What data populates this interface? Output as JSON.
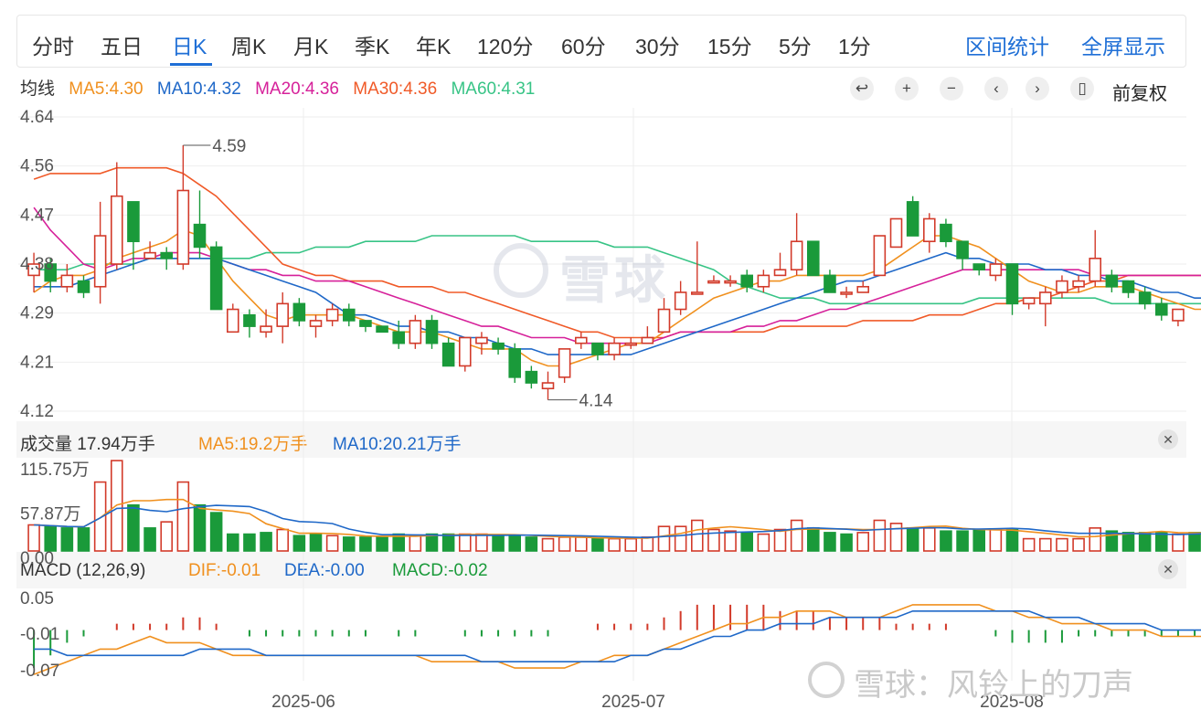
{
  "tabs": [
    "分时",
    "五日",
    "日K",
    "周K",
    "月K",
    "季K",
    "年K",
    "120分",
    "60分",
    "30分",
    "15分",
    "5分",
    "1分"
  ],
  "active_tab": "日K",
  "right_tabs": [
    "区间统计",
    "全屏显示"
  ],
  "ma_legend": {
    "label": "均线",
    "ma5": "MA5:4.30",
    "ma10": "MA10:4.32",
    "ma20": "MA20:4.36",
    "ma30": "MA30:4.36",
    "ma60": "MA60:4.31"
  },
  "toolbar": {
    "icons": [
      "undo-icon",
      "zoom-in-icon",
      "zoom-out-icon",
      "scroll-left-icon",
      "scroll-right-icon",
      "candle-type-icon"
    ],
    "fuquan": "前复权"
  },
  "volume_legend": {
    "label": "成交量 17.94万手",
    "ma5": "MA5:19.2万手",
    "ma10": "MA10:20.21万手"
  },
  "macd_legend": {
    "label": "MACD (12,26,9)",
    "dif": "DIF:-0.01",
    "dea": "DEA:-0.00",
    "macd": "MACD:-0.02"
  },
  "watermark": {
    "center": "雪球",
    "bottom_right": "雪球：风铃上的刀声"
  },
  "colors": {
    "up": "#d23a2a",
    "down": "#1a9a3a",
    "ma5": "#f0901e",
    "ma10": "#1f68c8",
    "ma20": "#d6219a",
    "ma30": "#f05a28",
    "ma60": "#38c486",
    "accent": "#1f6fd6"
  },
  "chart_data": {
    "type": "candlestick",
    "x_ticks": [
      "2025-06",
      "2025-07",
      "2025-08"
    ],
    "price_ticks": [
      "4.64",
      "4.56",
      "4.47",
      "4.38",
      "4.29",
      "4.21",
      "4.12"
    ],
    "price_ylim": [
      4.12,
      4.64
    ],
    "high_label": "4.59",
    "low_label": "4.14",
    "volume_ticks": [
      "115.75万",
      "57.87万",
      "0.00"
    ],
    "volume_ylim": [
      0,
      115.75
    ],
    "macd_ticks": [
      "0.05",
      "-0.01",
      "-0.07"
    ],
    "macd_ylim": [
      -0.08,
      0.06
    ],
    "candles": [
      {
        "o": 4.36,
        "c": 4.38,
        "h": 4.4,
        "l": 4.33
      },
      {
        "o": 4.38,
        "c": 4.35,
        "h": 4.39,
        "l": 4.33
      },
      {
        "o": 4.34,
        "c": 4.36,
        "h": 4.38,
        "l": 4.33
      },
      {
        "o": 4.35,
        "c": 4.33,
        "h": 4.36,
        "l": 4.32
      },
      {
        "o": 4.34,
        "c": 4.43,
        "h": 4.49,
        "l": 4.31
      },
      {
        "o": 4.38,
        "c": 4.5,
        "h": 4.56,
        "l": 4.37
      },
      {
        "o": 4.49,
        "c": 4.42,
        "h": 4.49,
        "l": 4.37
      },
      {
        "o": 4.39,
        "c": 4.4,
        "h": 4.42,
        "l": 4.39
      },
      {
        "o": 4.4,
        "c": 4.39,
        "h": 4.41,
        "l": 4.37
      },
      {
        "o": 4.38,
        "c": 4.51,
        "h": 4.59,
        "l": 4.37
      },
      {
        "o": 4.45,
        "c": 4.41,
        "h": 4.51,
        "l": 4.39
      },
      {
        "o": 4.41,
        "c": 4.3,
        "h": 4.42,
        "l": 4.3
      },
      {
        "o": 4.26,
        "c": 4.3,
        "h": 4.31,
        "l": 4.26
      },
      {
        "o": 4.29,
        "c": 4.27,
        "h": 4.3,
        "l": 4.25
      },
      {
        "o": 4.26,
        "c": 4.27,
        "h": 4.3,
        "l": 4.25
      },
      {
        "o": 4.27,
        "c": 4.31,
        "h": 4.33,
        "l": 4.24
      },
      {
        "o": 4.31,
        "c": 4.28,
        "h": 4.32,
        "l": 4.27
      },
      {
        "o": 4.27,
        "c": 4.28,
        "h": 4.29,
        "l": 4.25
      },
      {
        "o": 4.28,
        "c": 4.3,
        "h": 4.31,
        "l": 4.27
      },
      {
        "o": 4.3,
        "c": 4.28,
        "h": 4.31,
        "l": 4.27
      },
      {
        "o": 4.28,
        "c": 4.27,
        "h": 4.28,
        "l": 4.26
      },
      {
        "o": 4.27,
        "c": 4.26,
        "h": 4.27,
        "l": 4.26
      },
      {
        "o": 4.26,
        "c": 4.24,
        "h": 4.28,
        "l": 4.23
      },
      {
        "o": 4.24,
        "c": 4.28,
        "h": 4.29,
        "l": 4.23
      },
      {
        "o": 4.28,
        "c": 4.24,
        "h": 4.29,
        "l": 4.23
      },
      {
        "o": 4.24,
        "c": 4.2,
        "h": 4.25,
        "l": 4.2
      },
      {
        "o": 4.2,
        "c": 4.25,
        "h": 4.25,
        "l": 4.19
      },
      {
        "o": 4.24,
        "c": 4.25,
        "h": 4.26,
        "l": 4.22
      },
      {
        "o": 4.24,
        "c": 4.23,
        "h": 4.25,
        "l": 4.22
      },
      {
        "o": 4.23,
        "c": 4.18,
        "h": 4.24,
        "l": 4.17
      },
      {
        "o": 4.19,
        "c": 4.17,
        "h": 4.2,
        "l": 4.16
      },
      {
        "o": 4.16,
        "c": 4.17,
        "h": 4.19,
        "l": 4.14
      },
      {
        "o": 4.18,
        "c": 4.23,
        "h": 4.23,
        "l": 4.17
      },
      {
        "o": 4.24,
        "c": 4.25,
        "h": 4.26,
        "l": 4.23
      },
      {
        "o": 4.24,
        "c": 4.22,
        "h": 4.24,
        "l": 4.21
      },
      {
        "o": 4.22,
        "c": 4.24,
        "h": 4.25,
        "l": 4.21
      },
      {
        "o": 4.24,
        "c": 4.24,
        "h": 4.25,
        "l": 4.23
      },
      {
        "o": 4.24,
        "c": 4.25,
        "h": 4.27,
        "l": 4.24
      },
      {
        "o": 4.26,
        "c": 4.3,
        "h": 4.32,
        "l": 4.26
      },
      {
        "o": 4.3,
        "c": 4.33,
        "h": 4.35,
        "l": 4.29
      },
      {
        "o": 4.33,
        "c": 4.33,
        "h": 4.42,
        "l": 4.33
      },
      {
        "o": 4.35,
        "c": 4.35,
        "h": 4.36,
        "l": 4.35
      },
      {
        "o": 4.35,
        "c": 4.35,
        "h": 4.36,
        "l": 4.34
      },
      {
        "o": 4.36,
        "c": 4.34,
        "h": 4.37,
        "l": 4.33
      },
      {
        "o": 4.34,
        "c": 4.36,
        "h": 4.37,
        "l": 4.33
      },
      {
        "o": 4.36,
        "c": 4.37,
        "h": 4.4,
        "l": 4.36
      },
      {
        "o": 4.37,
        "c": 4.42,
        "h": 4.47,
        "l": 4.36
      },
      {
        "o": 4.42,
        "c": 4.36,
        "h": 4.42,
        "l": 4.36
      },
      {
        "o": 4.36,
        "c": 4.33,
        "h": 4.37,
        "l": 4.33
      },
      {
        "o": 4.33,
        "c": 4.33,
        "h": 4.34,
        "l": 4.32
      },
      {
        "o": 4.33,
        "c": 4.34,
        "h": 4.35,
        "l": 4.33
      },
      {
        "o": 4.36,
        "c": 4.43,
        "h": 4.43,
        "l": 4.36
      },
      {
        "o": 4.41,
        "c": 4.46,
        "h": 4.46,
        "l": 4.41
      },
      {
        "o": 4.49,
        "c": 4.43,
        "h": 4.5,
        "l": 4.43
      },
      {
        "o": 4.42,
        "c": 4.46,
        "h": 4.47,
        "l": 4.4
      },
      {
        "o": 4.45,
        "c": 4.42,
        "h": 4.46,
        "l": 4.41
      },
      {
        "o": 4.42,
        "c": 4.39,
        "h": 4.42,
        "l": 4.37
      },
      {
        "o": 4.38,
        "c": 4.37,
        "h": 4.38,
        "l": 4.36
      },
      {
        "o": 4.36,
        "c": 4.38,
        "h": 4.39,
        "l": 4.35
      },
      {
        "o": 4.38,
        "c": 4.31,
        "h": 4.38,
        "l": 4.29
      },
      {
        "o": 4.31,
        "c": 4.32,
        "h": 4.32,
        "l": 4.3
      },
      {
        "o": 4.31,
        "c": 4.33,
        "h": 4.34,
        "l": 4.27
      },
      {
        "o": 4.33,
        "c": 4.35,
        "h": 4.36,
        "l": 4.32
      },
      {
        "o": 4.34,
        "c": 4.35,
        "h": 4.36,
        "l": 4.33
      },
      {
        "o": 4.35,
        "c": 4.39,
        "h": 4.44,
        "l": 4.34
      },
      {
        "o": 4.36,
        "c": 4.34,
        "h": 4.37,
        "l": 4.33
      },
      {
        "o": 4.35,
        "c": 4.33,
        "h": 4.35,
        "l": 4.32
      },
      {
        "o": 4.33,
        "c": 4.31,
        "h": 4.34,
        "l": 4.3
      },
      {
        "o": 4.31,
        "c": 4.29,
        "h": 4.32,
        "l": 4.28
      },
      {
        "o": 4.28,
        "c": 4.3,
        "h": 4.3,
        "l": 4.27
      }
    ],
    "volume": [
      34,
      32,
      30,
      30,
      90,
      118,
      60,
      30,
      38,
      90,
      60,
      50,
      22,
      22,
      24,
      28,
      20,
      22,
      20,
      18,
      18,
      18,
      22,
      20,
      22,
      22,
      22,
      22,
      20,
      20,
      18,
      16,
      18,
      18,
      16,
      16,
      16,
      18,
      32,
      32,
      40,
      28,
      26,
      24,
      22,
      28,
      40,
      30,
      24,
      22,
      24,
      40,
      36,
      30,
      30,
      26,
      26,
      28,
      28,
      28,
      16,
      16,
      16,
      16,
      30,
      26,
      24,
      24,
      24,
      22,
      24,
      22
    ],
    "vol_up": [
      1,
      0,
      0,
      0,
      1,
      1,
      0,
      0,
      1,
      1,
      0,
      0,
      0,
      0,
      0,
      1,
      0,
      0,
      1,
      0,
      0,
      0,
      0,
      1,
      0,
      0,
      1,
      1,
      0,
      0,
      0,
      1,
      1,
      1,
      0,
      1,
      1,
      1,
      1,
      1,
      1,
      1,
      1,
      0,
      1,
      1,
      1,
      0,
      0,
      0,
      1,
      1,
      1,
      0,
      1,
      0,
      0,
      0,
      1,
      0,
      1,
      1,
      1,
      1,
      1,
      0,
      0,
      0,
      0,
      1,
      0,
      1
    ],
    "macd_hist": [
      -0.06,
      -0.04,
      -0.02,
      -0.01,
      0.0,
      0.01,
      0.01,
      0.01,
      0.01,
      0.02,
      0.02,
      0.01,
      0.0,
      -0.01,
      -0.01,
      -0.01,
      -0.01,
      -0.01,
      -0.01,
      -0.01,
      -0.01,
      0.0,
      -0.01,
      -0.01,
      0.0,
      0.0,
      -0.01,
      -0.01,
      -0.01,
      -0.01,
      -0.01,
      -0.01,
      0.0,
      0.0,
      0.01,
      0.01,
      0.01,
      0.01,
      0.02,
      0.03,
      0.04,
      0.04,
      0.04,
      0.04,
      0.04,
      0.03,
      0.03,
      0.03,
      0.02,
      0.02,
      0.02,
      0.02,
      0.01,
      0.01,
      0.01,
      0.01,
      0.0,
      0.0,
      -0.01,
      -0.02,
      -0.02,
      -0.02,
      -0.02,
      -0.01,
      -0.01,
      -0.01,
      -0.01,
      -0.01,
      -0.01,
      -0.01,
      -0.01,
      -0.02
    ],
    "ma_series": {
      "ma5": [
        4.33,
        4.35,
        4.36,
        4.36,
        4.37,
        4.39,
        4.4,
        4.41,
        4.42,
        4.44,
        4.43,
        4.39,
        4.35,
        4.32,
        4.29,
        4.28,
        4.29,
        4.29,
        4.29,
        4.29,
        4.28,
        4.27,
        4.26,
        4.26,
        4.26,
        4.25,
        4.24,
        4.23,
        4.23,
        4.23,
        4.21,
        4.2,
        4.2,
        4.21,
        4.22,
        4.23,
        4.24,
        4.24,
        4.26,
        4.28,
        4.3,
        4.32,
        4.33,
        4.34,
        4.35,
        4.35,
        4.36,
        4.36,
        4.36,
        4.36,
        4.36,
        4.37,
        4.39,
        4.41,
        4.43,
        4.43,
        4.42,
        4.41,
        4.39,
        4.37,
        4.35,
        4.34,
        4.33,
        4.33,
        4.34,
        4.34,
        4.34,
        4.33,
        4.32,
        4.31,
        4.3,
        4.3
      ],
      "ma10": [
        4.34,
        4.34,
        4.34,
        4.35,
        4.36,
        4.37,
        4.38,
        4.39,
        4.39,
        4.39,
        4.39,
        4.39,
        4.38,
        4.37,
        4.36,
        4.35,
        4.34,
        4.33,
        4.31,
        4.29,
        4.29,
        4.28,
        4.27,
        4.27,
        4.26,
        4.26,
        4.25,
        4.25,
        4.24,
        4.23,
        4.23,
        4.22,
        4.22,
        4.22,
        4.22,
        4.22,
        4.22,
        4.23,
        4.24,
        4.25,
        4.26,
        4.27,
        4.28,
        4.29,
        4.3,
        4.31,
        4.32,
        4.33,
        4.34,
        4.35,
        4.35,
        4.36,
        4.37,
        4.38,
        4.39,
        4.4,
        4.39,
        4.39,
        4.38,
        4.38,
        4.38,
        4.37,
        4.37,
        4.36,
        4.36,
        4.35,
        4.35,
        4.34,
        4.33,
        4.33,
        4.32,
        4.32
      ],
      "ma20": [
        4.48,
        4.44,
        4.41,
        4.38,
        4.37,
        4.38,
        4.39,
        4.39,
        4.4,
        4.4,
        4.4,
        4.39,
        4.38,
        4.37,
        4.37,
        4.36,
        4.36,
        4.35,
        4.35,
        4.35,
        4.34,
        4.33,
        4.32,
        4.31,
        4.3,
        4.29,
        4.28,
        4.27,
        4.27,
        4.26,
        4.25,
        4.25,
        4.25,
        4.24,
        4.24,
        4.24,
        4.24,
        4.24,
        4.25,
        4.26,
        4.26,
        4.26,
        4.26,
        4.27,
        4.27,
        4.28,
        4.28,
        4.29,
        4.3,
        4.3,
        4.31,
        4.32,
        4.33,
        4.34,
        4.35,
        4.36,
        4.37,
        4.37,
        4.37,
        4.37,
        4.37,
        4.37,
        4.37,
        4.37,
        4.36,
        4.36,
        4.36,
        4.36,
        4.36,
        4.36,
        4.36,
        4.36
      ],
      "ma30": [
        4.53,
        4.54,
        4.54,
        4.54,
        4.54,
        4.55,
        4.55,
        4.55,
        4.55,
        4.54,
        4.52,
        4.5,
        4.47,
        4.44,
        4.41,
        4.38,
        4.37,
        4.36,
        4.36,
        4.35,
        4.35,
        4.35,
        4.34,
        4.34,
        4.34,
        4.33,
        4.33,
        4.32,
        4.31,
        4.3,
        4.29,
        4.28,
        4.27,
        4.26,
        4.26,
        4.25,
        4.25,
        4.25,
        4.25,
        4.26,
        4.26,
        4.26,
        4.26,
        4.26,
        4.26,
        4.27,
        4.27,
        4.27,
        4.27,
        4.27,
        4.28,
        4.28,
        4.28,
        4.28,
        4.29,
        4.29,
        4.29,
        4.3,
        4.31,
        4.31,
        4.32,
        4.32,
        4.33,
        4.34,
        4.35,
        4.35,
        4.36,
        4.36,
        4.36,
        4.36,
        4.36,
        4.36
      ],
      "ma60": [
        4.37,
        4.37,
        4.37,
        4.38,
        4.38,
        4.38,
        4.38,
        4.39,
        4.39,
        4.39,
        4.39,
        4.39,
        4.39,
        4.39,
        4.4,
        4.4,
        4.4,
        4.41,
        4.41,
        4.41,
        4.42,
        4.42,
        4.42,
        4.42,
        4.43,
        4.43,
        4.43,
        4.43,
        4.43,
        4.43,
        4.42,
        4.42,
        4.42,
        4.42,
        4.42,
        4.41,
        4.41,
        4.41,
        4.4,
        4.39,
        4.38,
        4.37,
        4.35,
        4.34,
        4.33,
        4.32,
        4.32,
        4.32,
        4.31,
        4.31,
        4.31,
        4.31,
        4.31,
        4.31,
        4.31,
        4.31,
        4.31,
        4.32,
        4.32,
        4.32,
        4.32,
        4.32,
        4.32,
        4.32,
        4.32,
        4.31,
        4.31,
        4.31,
        4.31,
        4.31,
        4.31,
        4.31
      ]
    },
    "macd_dif": [
      -0.07,
      -0.06,
      -0.05,
      -0.04,
      -0.03,
      -0.03,
      -0.02,
      -0.01,
      -0.02,
      -0.02,
      -0.02,
      -0.03,
      -0.04,
      -0.04,
      -0.04,
      -0.04,
      -0.04,
      -0.04,
      -0.04,
      -0.04,
      -0.04,
      -0.04,
      -0.04,
      -0.04,
      -0.05,
      -0.05,
      -0.05,
      -0.05,
      -0.05,
      -0.06,
      -0.06,
      -0.06,
      -0.06,
      -0.05,
      -0.05,
      -0.04,
      -0.04,
      -0.04,
      -0.03,
      -0.02,
      -0.01,
      0.0,
      0.01,
      0.01,
      0.02,
      0.02,
      0.03,
      0.03,
      0.03,
      0.02,
      0.02,
      0.02,
      0.03,
      0.04,
      0.04,
      0.04,
      0.04,
      0.04,
      0.03,
      0.03,
      0.02,
      0.02,
      0.01,
      0.01,
      0.01,
      0.0,
      0.0,
      0.0,
      -0.01,
      -0.01,
      -0.01,
      -0.01
    ],
    "macd_dea": [
      -0.03,
      -0.03,
      -0.04,
      -0.04,
      -0.04,
      -0.04,
      -0.04,
      -0.04,
      -0.04,
      -0.04,
      -0.03,
      -0.03,
      -0.03,
      -0.03,
      -0.04,
      -0.04,
      -0.04,
      -0.04,
      -0.04,
      -0.04,
      -0.04,
      -0.04,
      -0.04,
      -0.04,
      -0.04,
      -0.04,
      -0.04,
      -0.05,
      -0.05,
      -0.05,
      -0.05,
      -0.05,
      -0.05,
      -0.05,
      -0.05,
      -0.05,
      -0.04,
      -0.04,
      -0.03,
      -0.03,
      -0.02,
      -0.01,
      -0.01,
      0.0,
      0.0,
      0.01,
      0.01,
      0.01,
      0.02,
      0.02,
      0.02,
      0.02,
      0.02,
      0.03,
      0.03,
      0.03,
      0.03,
      0.03,
      0.03,
      0.03,
      0.03,
      0.02,
      0.02,
      0.02,
      0.01,
      0.01,
      0.01,
      0.01,
      0.0,
      0.0,
      0.0,
      0.0
    ]
  }
}
